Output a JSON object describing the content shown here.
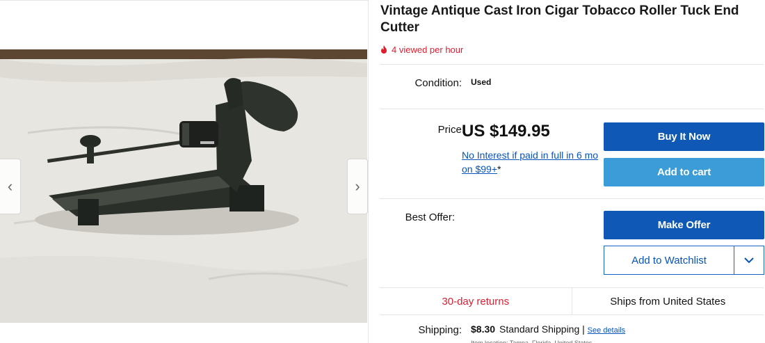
{
  "listing": {
    "title": "Vintage Antique Cast Iron Cigar Tobacco Roller Tuck End Cutter",
    "views": "4 viewed per hour",
    "condition_label": "Condition:",
    "condition_value": "Used",
    "price_label": "Price:",
    "price": "US $149.95",
    "financing_text": "No Interest if paid in full in 6 mo on $99+",
    "financing_star": "*",
    "best_offer_label": "Best Offer:",
    "returns": "30-day returns",
    "ships_from": "Ships from United States",
    "shipping_label": "Shipping:",
    "shipping_cost": "$8.30",
    "shipping_method": "Standard Shipping",
    "shipping_sep": " | ",
    "shipping_details_link": "See details",
    "shipping_sub": "Item location: Tampa, Florida, United States"
  },
  "buttons": {
    "buy_now": "Buy It Now",
    "add_to_cart": "Add to cart",
    "make_offer": "Make Offer",
    "add_to_watchlist": "Add to Watchlist"
  },
  "gallery": {
    "prev_icon": "‹",
    "next_icon": "›"
  },
  "colors": {
    "primary_blue": "#0f58b5",
    "secondary_blue": "#3b9cd8",
    "link_blue": "#0654ba",
    "alert_red": "#dd1e31"
  },
  "icons": {
    "views": "flame-icon",
    "watch_dropdown": "chevron-down-icon",
    "prev": "chevron-left-icon",
    "next": "chevron-right-icon"
  }
}
